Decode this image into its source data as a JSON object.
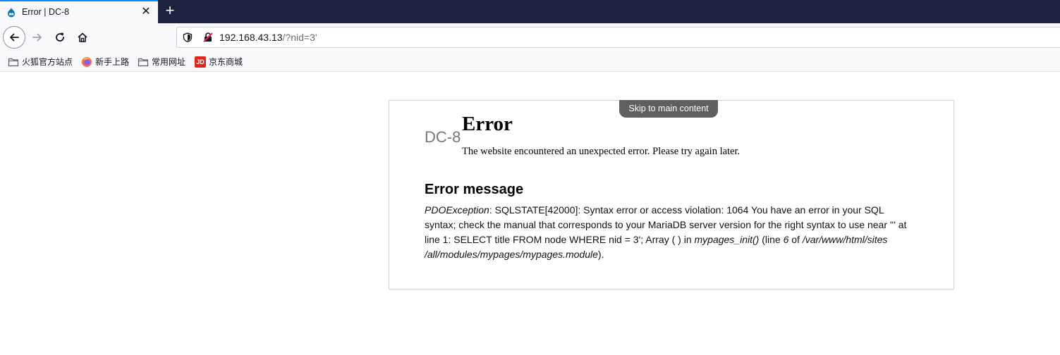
{
  "tab": {
    "title": "Error | DC-8",
    "close_glyph": "✕",
    "newtab_glyph": "+"
  },
  "urlbar": {
    "host": "192.168.43.13",
    "path": "/?nid=3'"
  },
  "bookmarks": [
    {
      "label": "火狐官方站点",
      "icon": "folder-icon"
    },
    {
      "label": "新手上路",
      "icon": "firefox-icon"
    },
    {
      "label": "常用网址",
      "icon": "folder-icon"
    },
    {
      "label": "京东商城",
      "icon": "jd-icon"
    }
  ],
  "jd_logo_text": "JD",
  "page": {
    "skip_link": "Skip to main content",
    "site_name": "DC-8",
    "title": "Error",
    "description": "The website encountered an unexpected error. Please try again later.",
    "message_heading": "Error message",
    "message": {
      "exception": "PDOException",
      "text1": ": SQLSTATE[42000]: Syntax error or access violation: 1064 You have an error in your SQL syntax; check the manual that corresponds to your MariaDB server version for the right syntax to use near ''' at line 1: SELECT title FROM node WHERE nid = 3'; Array ( ) in ",
      "function": "mypages_init()",
      "text2": " (line ",
      "line": "6",
      "text3": " of ",
      "file": "/var/www/html/sites /all/modules/mypages/mypages.module",
      "text4": ")."
    }
  },
  "colors": {
    "tabstrip_bg": "#202340",
    "tab_accent": "#0a84ff",
    "toolbar_bg": "#f9f9fb",
    "drupal_blue": "#0678be"
  }
}
